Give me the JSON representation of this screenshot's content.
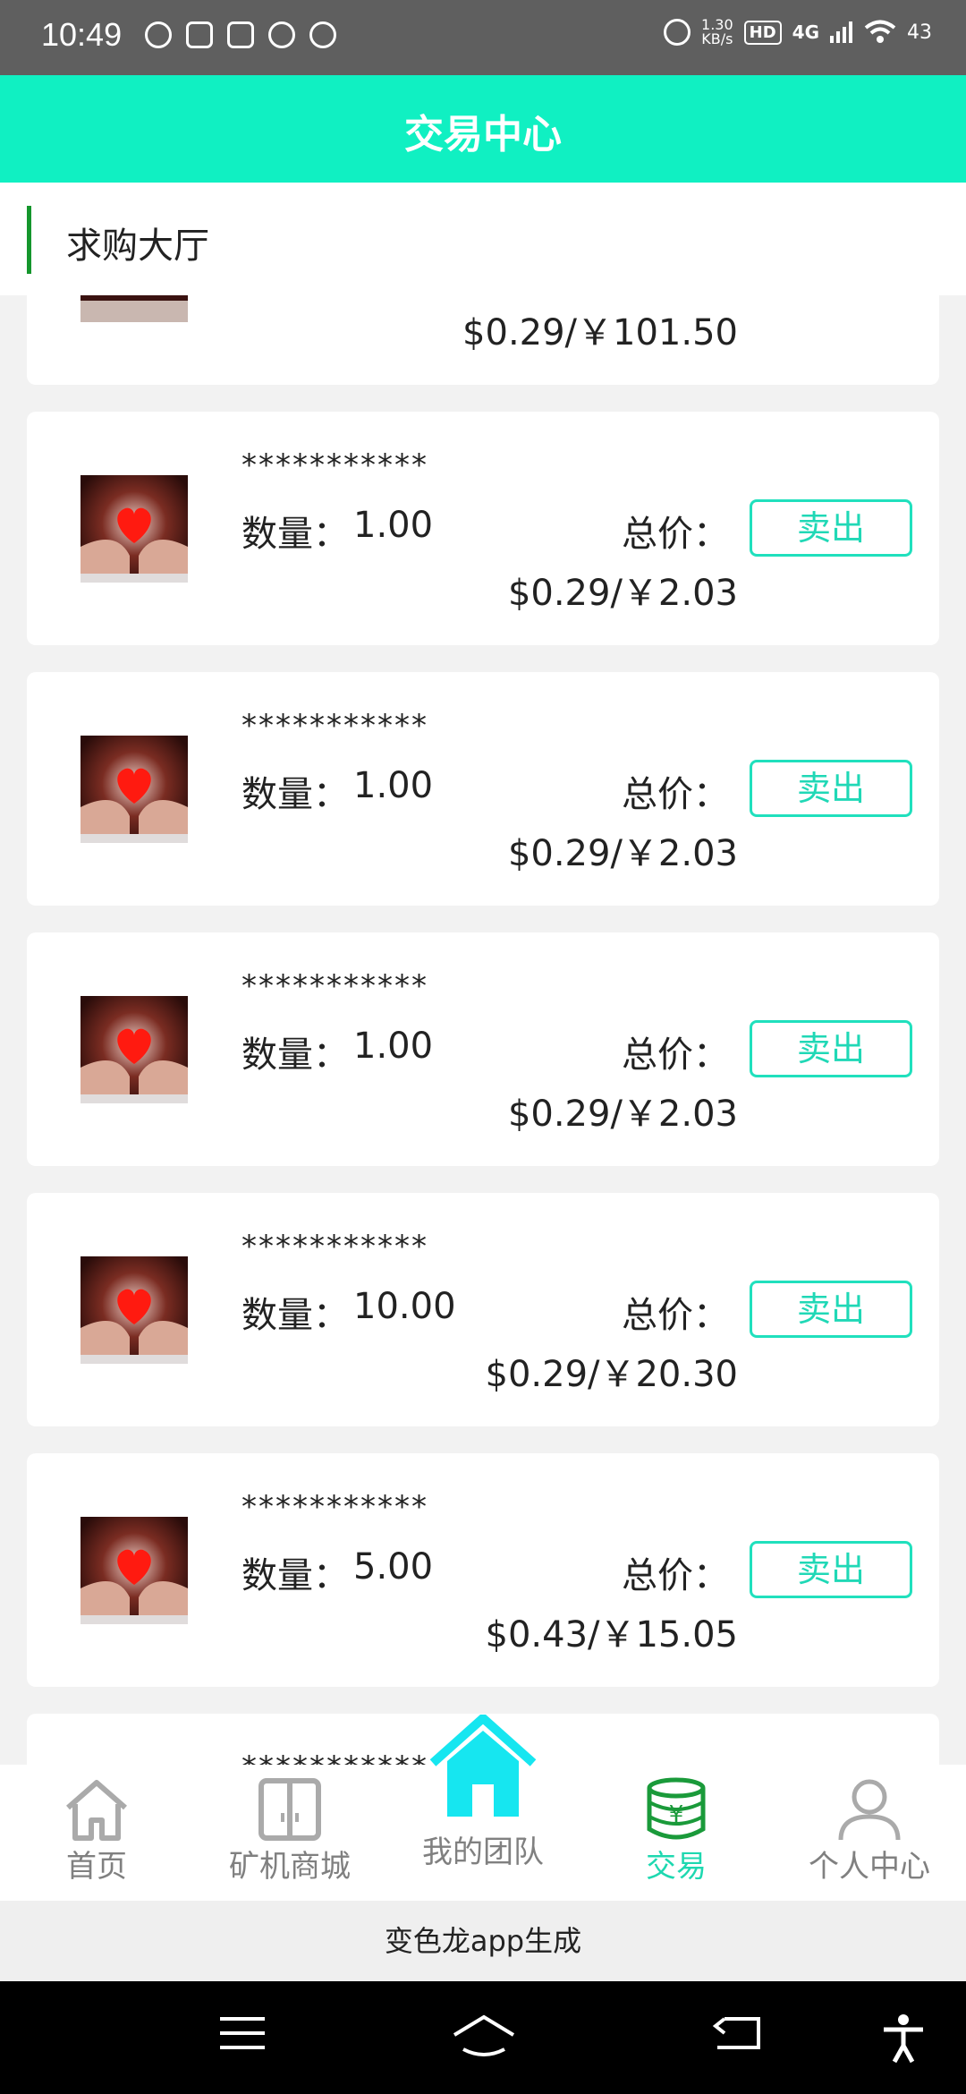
{
  "status_bar": {
    "time": "10:49",
    "speed_value": "1.30",
    "speed_unit": "KB/s",
    "hd": "HD",
    "network": "4G",
    "battery": "43"
  },
  "header": {
    "title": "交易中心"
  },
  "section": {
    "title": "求购大厅"
  },
  "labels": {
    "quantity": "数量：",
    "total": "总价：",
    "sell": "卖出"
  },
  "partial_top": {
    "price": "$0.29/￥101.50"
  },
  "orders": [
    {
      "name": "***********",
      "quantity": "1.00",
      "price": "$0.29/￥2.03"
    },
    {
      "name": "***********",
      "quantity": "1.00",
      "price": "$0.29/￥2.03"
    },
    {
      "name": "***********",
      "quantity": "1.00",
      "price": "$0.29/￥2.03"
    },
    {
      "name": "***********",
      "quantity": "10.00",
      "price": "$0.29/￥20.30"
    },
    {
      "name": "***********",
      "quantity": "5.00",
      "price": "$0.43/￥15.05"
    }
  ],
  "partial_bottom": {
    "name": "***********"
  },
  "tabbar": {
    "items": [
      {
        "label": "首页",
        "icon": "home-outline-icon"
      },
      {
        "label": "矿机商城",
        "icon": "door-icon"
      },
      {
        "label": "我的团队",
        "icon": "house-filled-icon"
      },
      {
        "label": "交易",
        "icon": "coin-stack-icon"
      },
      {
        "label": "个人中心",
        "icon": "person-icon"
      }
    ],
    "active_color": "#1ed8b0",
    "inactive_color": "#808080"
  },
  "brand": {
    "text": "变色龙app生成"
  },
  "colors": {
    "accent": "#10f0c2",
    "section_bar": "#15962c"
  }
}
